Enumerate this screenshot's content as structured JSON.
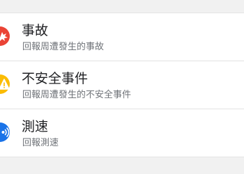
{
  "colors": {
    "crash": "#ea4335",
    "hazard": "#fbbc04",
    "speed_trap": "#1a73e8"
  },
  "report_options": [
    {
      "title": "事故",
      "subtitle": "回報周遭發生的事故",
      "icon": "crash-icon"
    },
    {
      "title": "不安全事件",
      "subtitle": "回報周遭發生的不安全事件",
      "icon": "hazard-warning-icon"
    },
    {
      "title": "測速",
      "subtitle": "回報測速",
      "icon": "speed-trap-icon"
    }
  ]
}
